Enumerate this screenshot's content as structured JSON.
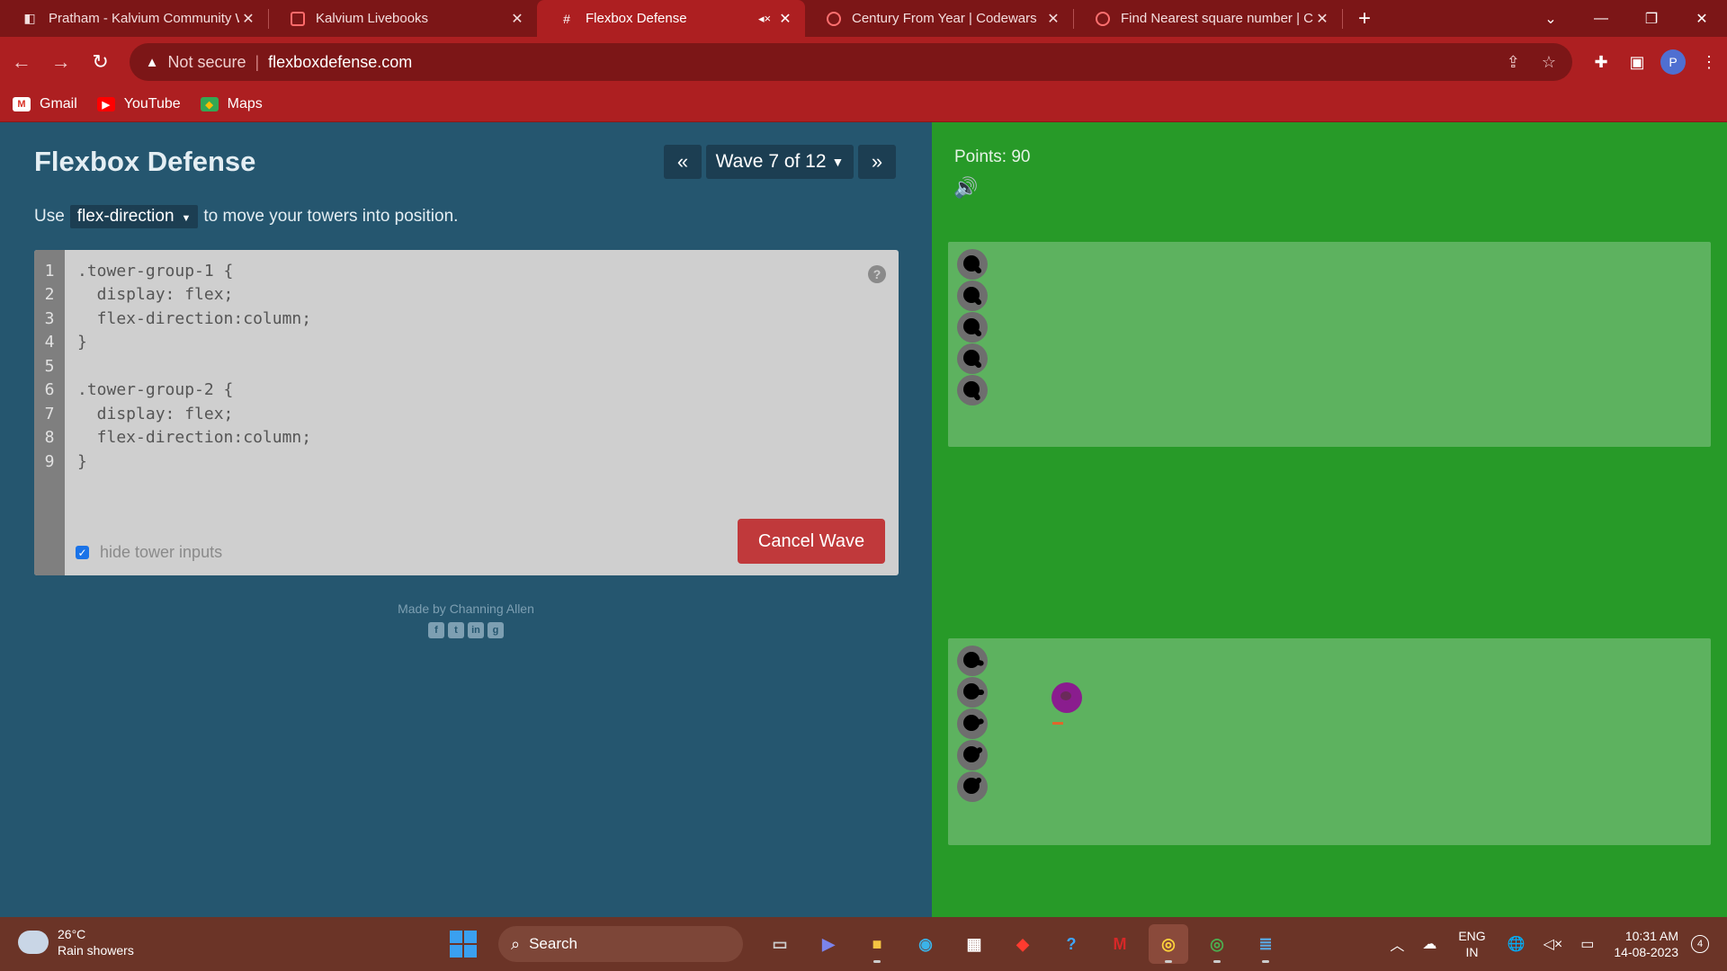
{
  "browser": {
    "tabs": [
      {
        "title": "Pratham - Kalvium Community W",
        "icon": "kalvium-community-icon",
        "active": false
      },
      {
        "title": "Kalvium Livebooks",
        "icon": "kalvium-livebooks-icon",
        "active": false
      },
      {
        "title": "Flexbox Defense",
        "icon": "flexbox-defense-icon",
        "active": true
      },
      {
        "title": "Century From Year | Codewars",
        "icon": "codewars-icon",
        "active": false
      },
      {
        "title": "Find Nearest square number | Co",
        "icon": "codewars-icon",
        "active": false
      }
    ],
    "address": {
      "security_label": "Not secure",
      "url": "flexboxdefense.com"
    },
    "profile_initial": "P",
    "bookmarks": [
      {
        "label": "Gmail",
        "icon": "gmail-icon"
      },
      {
        "label": "YouTube",
        "icon": "youtube-icon"
      },
      {
        "label": "Maps",
        "icon": "maps-icon"
      }
    ]
  },
  "game": {
    "title": "Flexbox Defense",
    "wave_label": "Wave 7 of 12",
    "instruction_prefix": "Use",
    "instruction_keyword": "flex-direction",
    "instruction_suffix": "to move your towers into position.",
    "code_lines": [
      ".tower-group-1 {",
      "  display: flex;",
      "  flex-direction:column;",
      "}",
      "",
      ".tower-group-2 {",
      "  display: flex;",
      "  flex-direction:column;",
      "}"
    ],
    "line_numbers": [
      "1",
      "2",
      "3",
      "4",
      "5",
      "6",
      "7",
      "8",
      "9"
    ],
    "hide_inputs_label": "hide tower inputs",
    "hide_inputs_checked": true,
    "cancel_label": "Cancel Wave",
    "credit": "Made by Channing Allen",
    "socials": [
      "facebook-icon",
      "twitter-icon",
      "linkedin-icon",
      "github-icon"
    ],
    "points_label": "Points: 90",
    "colors": {
      "panel": "#25566f",
      "board": "#279a28",
      "zone": "#5db25f",
      "cancel": "#c0393b",
      "enemy": "#8a1d8e"
    }
  },
  "taskbar": {
    "temperature": "26°C",
    "weather": "Rain showers",
    "search_placeholder": "Search",
    "lang_top": "ENG",
    "lang_bottom": "IN",
    "time": "10:31 AM",
    "date": "14-08-2023",
    "notification_count": "4"
  }
}
